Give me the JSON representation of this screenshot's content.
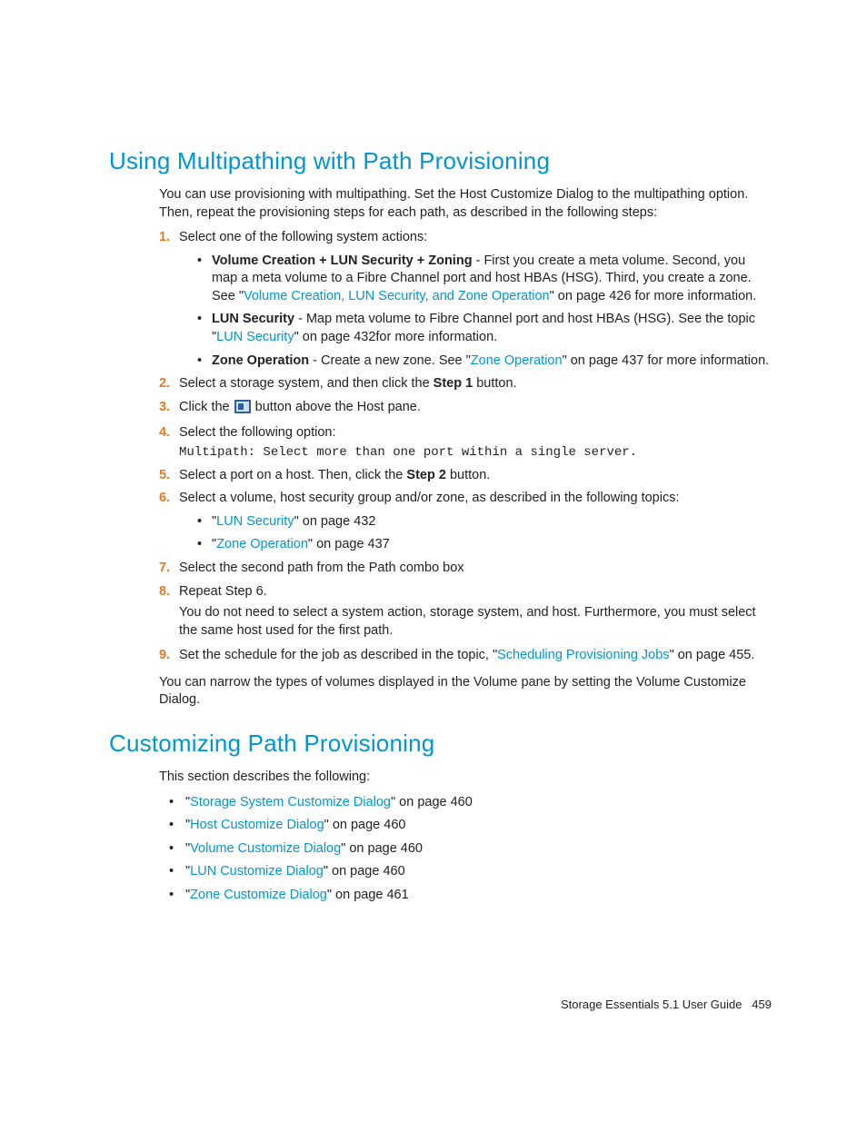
{
  "section1": {
    "heading": "Using Multipathing with Path Provisioning",
    "intro": "You can use provisioning with multipathing. Set the Host Customize Dialog to the multipathing option. Then, repeat the provisioning steps for each path, as described in the following steps:",
    "steps": {
      "s1": {
        "num": "1.",
        "text": "Select one of the following system actions:",
        "bullets": {
          "b1_strong": "Volume Creation + LUN Security + Zoning",
          "b1_rest": " - First you create a meta volume. Second, you map a meta volume to a Fibre Channel port and host HBAs (HSG). Third, you create a zone. See \"",
          "b1_link": "Volume Creation, LUN Security, and Zone Operation",
          "b1_tail": "\" on page 426 for more information.",
          "b2_strong": "LUN Security",
          "b2_rest": " - Map meta volume to Fibre Channel port and host HBAs (HSG). See the topic \"",
          "b2_link": "LUN Security",
          "b2_tail": "\" on page 432for more information.",
          "b3_strong": "Zone Operation",
          "b3_rest": " - Create a new zone. See \"",
          "b3_link": "Zone Operation",
          "b3_tail": "\" on page 437 for more information."
        }
      },
      "s2": {
        "num": "2.",
        "pre": "Select a storage system, and then click the ",
        "strong": "Step 1",
        "post": " button."
      },
      "s3": {
        "num": "3.",
        "pre": "Click the ",
        "post": " button above the Host pane."
      },
      "s4": {
        "num": "4.",
        "text": "Select the following option:",
        "mono": "Multipath: Select more than one port within a single server."
      },
      "s5": {
        "num": "5.",
        "pre": "Select a port on a host. Then, click the ",
        "strong": "Step 2",
        "post": " button."
      },
      "s6": {
        "num": "6.",
        "text": "Select a volume, host security group and/or zone, as described in the following topics:",
        "b1_q1": "\"",
        "b1_link": "LUN Security",
        "b1_tail": "\" on page 432",
        "b2_q1": "\"",
        "b2_link": "Zone Operation",
        "b2_tail": "\" on page 437"
      },
      "s7": {
        "num": "7.",
        "text": "Select the second path from the Path combo box"
      },
      "s8": {
        "num": "8.",
        "text": "Repeat Step 6.",
        "follow": "You do not need to select a system action, storage system, and host. Furthermore, you must select the same host used for the first path."
      },
      "s9": {
        "num": "9.",
        "pre": "Set the schedule for the job as described in the topic, \"",
        "link": "Scheduling Provisioning Jobs",
        "post": "\" on page 455."
      }
    },
    "outro": "You can narrow the types of volumes displayed in the Volume pane by setting the Volume Customize Dialog."
  },
  "section2": {
    "heading": "Customizing Path Provisioning",
    "intro": "This section describes the following:",
    "items": {
      "i1_link": "Storage System Customize Dialog",
      "i1_tail": "\" on page 460",
      "i2_link": "Host Customize Dialog",
      "i2_tail": "\" on page 460",
      "i3_link": "Volume Customize Dialog",
      "i3_tail": "\" on page 460",
      "i4_link": "LUN Customize Dialog",
      "i4_tail": "\" on page 460",
      "i5_link": "Zone Customize Dialog",
      "i5_tail": "\" on page 461"
    }
  },
  "footer": {
    "title": "Storage Essentials 5.1 User Guide",
    "page": "459"
  },
  "quote": "\""
}
